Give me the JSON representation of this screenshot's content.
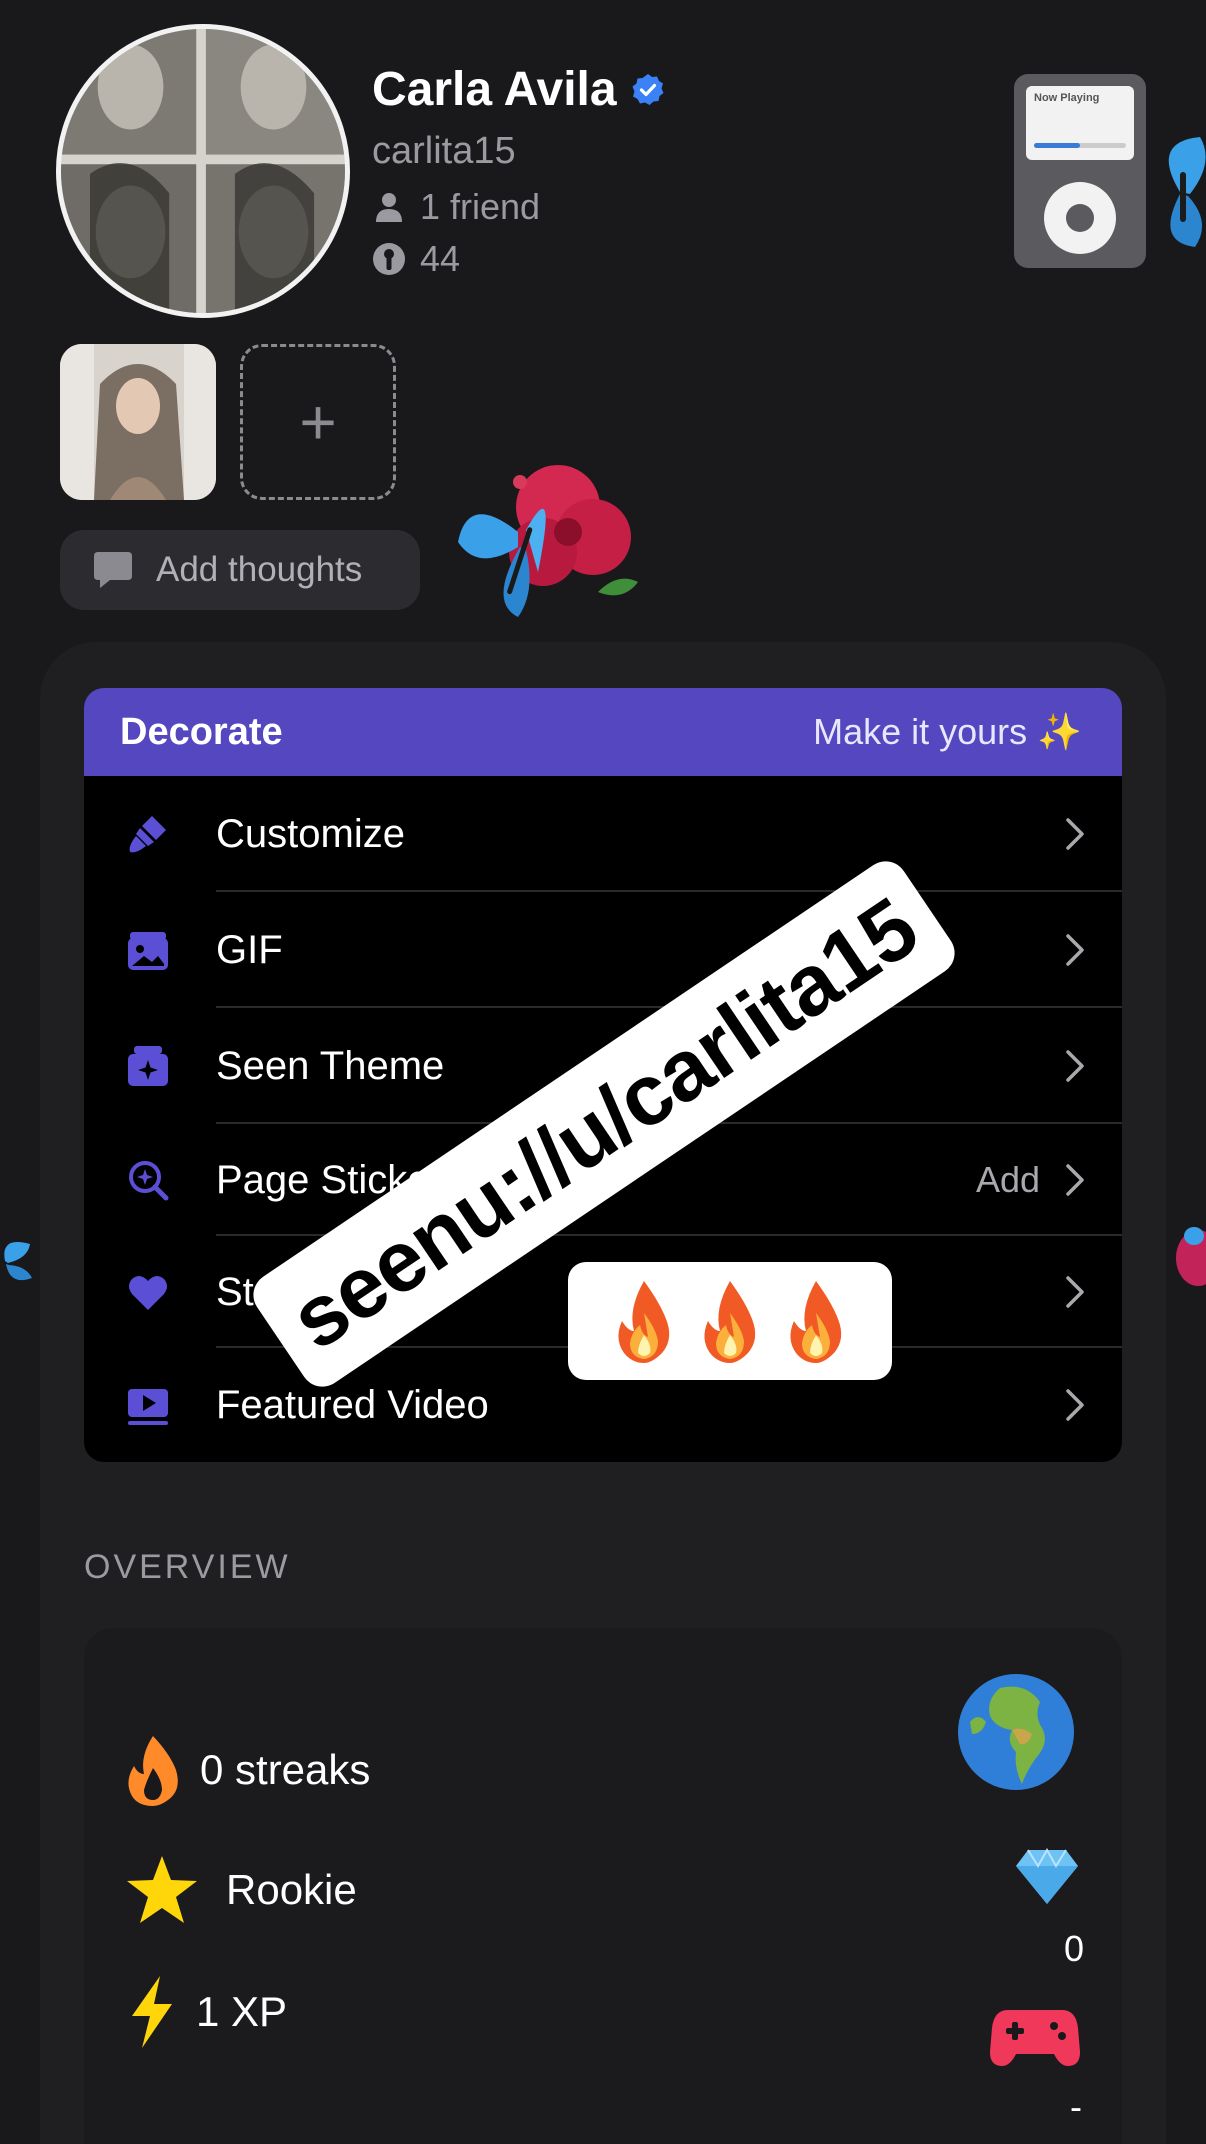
{
  "profile": {
    "display_name": "Carla Avila",
    "username": "carlita15",
    "friends": "1 friend",
    "score": "44",
    "verified": true
  },
  "now_playing": {
    "label": "Now Playing"
  },
  "thoughts": {
    "label": "Add thoughts"
  },
  "add_photo": {
    "label": "+"
  },
  "decorate": {
    "title": "Decorate",
    "subtitle": "Make it yours ✨",
    "items": [
      {
        "label": "Customize",
        "icon": "paintbrush-icon",
        "right": ""
      },
      {
        "label": "GIF",
        "icon": "photo-icon",
        "right": ""
      },
      {
        "label": "Seen Theme",
        "icon": "sparkle-square-icon",
        "right": ""
      },
      {
        "label": "Page Sticke",
        "icon": "magnify-sparkle-icon",
        "right": "Add"
      },
      {
        "label": "St",
        "icon": "heart-icon",
        "right": ""
      },
      {
        "label": "Featured Video",
        "icon": "play-video-icon",
        "right": ""
      }
    ]
  },
  "stickers": {
    "url": "seenu://u/carlita15",
    "fire": "🔥🔥🔥"
  },
  "overview": {
    "title": "OVERVIEW",
    "streaks": "0 streaks",
    "rank": "Rookie",
    "xp": "1 XP",
    "gems": "0",
    "games": "-"
  },
  "colors": {
    "background": "#19191c",
    "accent": "#5447c0",
    "icon_purple": "#5b4fd6",
    "verified_blue": "#3b82f6"
  }
}
